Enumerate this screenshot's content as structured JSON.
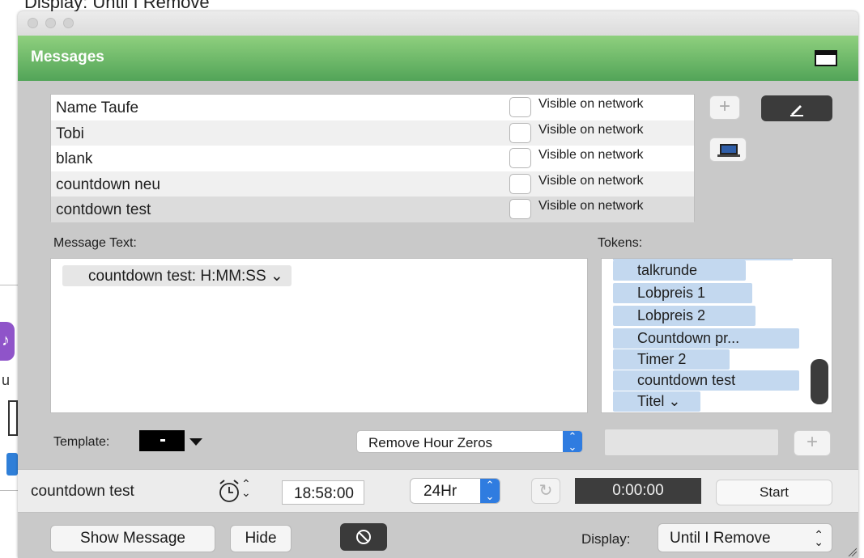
{
  "background": {
    "caption": "Display: Until I Remove"
  },
  "window": {
    "title": "Messages"
  },
  "messages": [
    {
      "name": "Name Taufe",
      "visible_label": "Visible on network",
      "checked": false
    },
    {
      "name": "Tobi",
      "visible_label": "Visible on network",
      "checked": false
    },
    {
      "name": "blank",
      "visible_label": "Visible on network",
      "checked": false
    },
    {
      "name": "countdown neu",
      "visible_label": "Visible on network",
      "checked": false
    },
    {
      "name": "contdown test",
      "visible_label": "Visible on network",
      "checked": false
    }
  ],
  "side_buttons": {
    "add_label": "+"
  },
  "message_text": {
    "label": "Message Text:",
    "token": "countdown test: H:MM:SS ⌄"
  },
  "tokens": {
    "label": "Tokens:",
    "items": [
      "talkrunde",
      "Lobpreis 1",
      "Lobpreis 2",
      "Countdown pr...",
      "Timer 2",
      "countdown test",
      "Titel ⌄"
    ]
  },
  "template": {
    "label": "Template:",
    "format_option": "Remove Hour Zeros",
    "add_label": "+"
  },
  "timer": {
    "name": "countdown test",
    "time": "18:58:00",
    "hour_format": "24Hr",
    "display": "0:00:00",
    "start_label": "Start"
  },
  "bottom": {
    "show_label": "Show Message",
    "hide_label": "Hide",
    "display_label": "Display:",
    "display_value": "Until I Remove"
  },
  "colors": {
    "header_top": "#8fd07e",
    "header_bottom": "#52a458",
    "accent_blue": "#2f7ce0",
    "token_blue": "#c3d8ef"
  },
  "icons": [
    "alarm-clock-icon",
    "pencil-icon",
    "monitor-icon",
    "reset-icon",
    "prohibit-icon",
    "window-icon"
  ]
}
